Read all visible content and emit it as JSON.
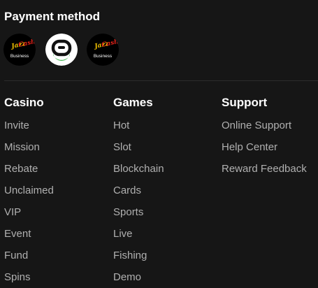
{
  "payment": {
    "title": "Payment method",
    "methods": [
      {
        "brand_top": "Jazz",
        "brand_bottom": "Cash",
        "sub": "Business",
        "icon": "jazzcash-logo"
      },
      {
        "icon": "easypaisa-logo"
      },
      {
        "brand_top": "Jazz",
        "brand_bottom": "Cash",
        "sub": "Business",
        "icon": "jazzcash-logo"
      }
    ]
  },
  "footer": {
    "columns": [
      {
        "title": "Casino",
        "links": [
          "Invite",
          "Mission",
          "Rebate",
          "Unclaimed",
          "VIP",
          "Event",
          "Fund",
          "Spins"
        ]
      },
      {
        "title": "Games",
        "links": [
          "Hot",
          "Slot",
          "Blockchain",
          "Cards",
          "Sports",
          "Live",
          "Fishing",
          "Demo"
        ]
      },
      {
        "title": "Support",
        "links": [
          "Online Support",
          "Help Center",
          "Reward Feedback"
        ]
      }
    ]
  },
  "colors": {
    "background": "#161616",
    "heading": "#ffffff",
    "link": "#b0b0b0",
    "divider": "#2c2c2c",
    "jazz_yellow": "#f5c400",
    "jazz_red": "#e2231a",
    "easypaisa_green": "#3bb54a"
  }
}
